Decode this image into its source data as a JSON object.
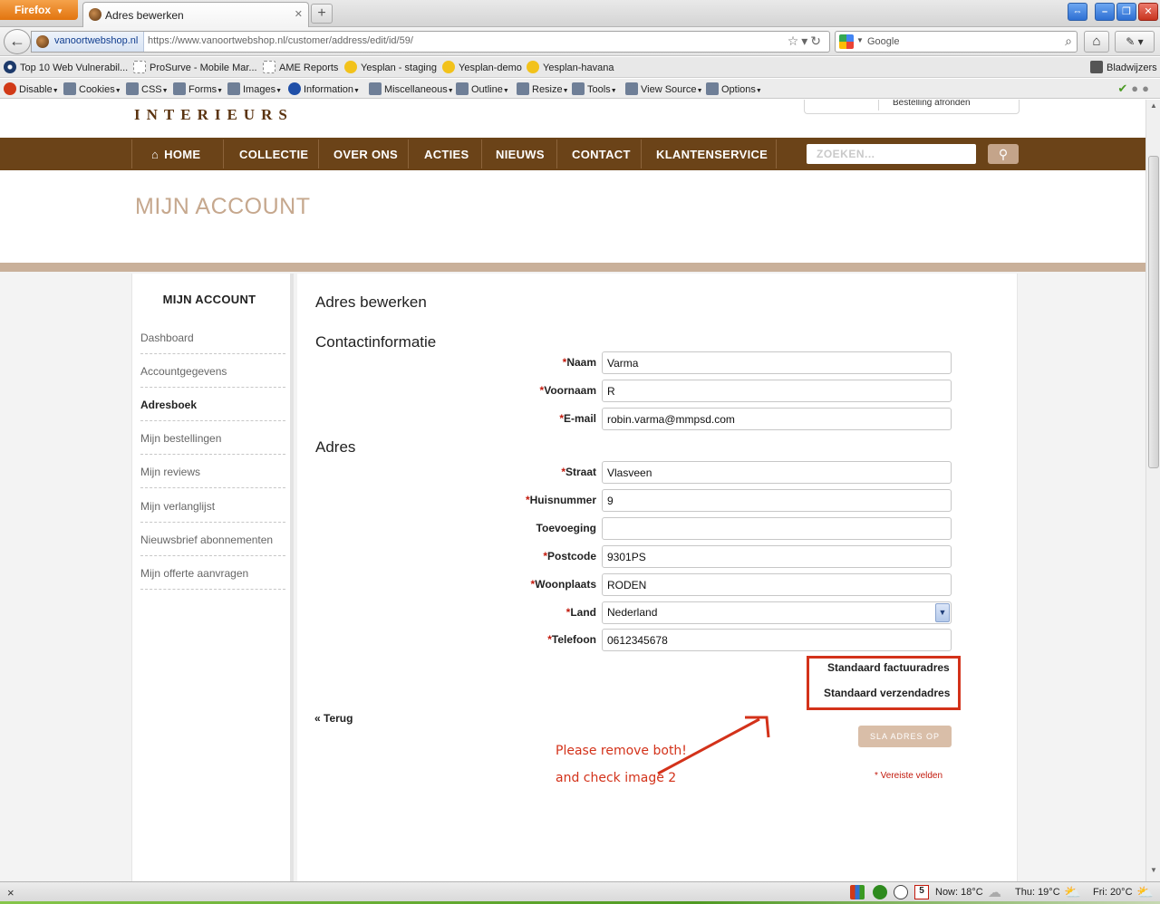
{
  "browser": {
    "app_button": "Firefox",
    "tab_title": "Adres bewerken",
    "site_identity": "vanoortwebshop.nl",
    "url": "https://www.vanoortwebshop.nl/customer/address/edit/id/59/",
    "search_placeholder": "Google"
  },
  "bookmarks": {
    "items": [
      "Top 10 Web Vulnerabil...",
      "ProSurve - Mobile Mar...",
      "AME Reports",
      "Yesplan - staging",
      "Yesplan-demo",
      "Yesplan-havana"
    ],
    "right": "Bladwijzers"
  },
  "webdev_toolbar": {
    "items": [
      "Disable",
      "Cookies",
      "CSS",
      "Forms",
      "Images",
      "Information",
      "Miscellaneous",
      "Outline",
      "Resize",
      "Tools",
      "View Source",
      "Options"
    ]
  },
  "site": {
    "logo_text": "INTERIEURS",
    "cart_link": "Bestelling afronden",
    "nav": [
      "HOME",
      "COLLECTIE",
      "OVER ONS",
      "ACTIES",
      "NIEUWS",
      "CONTACT",
      "KLANTENSERVICE"
    ],
    "search_placeholder": "ZOEKEN...",
    "page_title": "MIJN ACCOUNT"
  },
  "sidebar": {
    "title": "MIJN ACCOUNT",
    "items": [
      "Dashboard",
      "Accountgegevens",
      "Adresboek",
      "Mijn bestellingen",
      "Mijn reviews",
      "Mijn verlanglijst",
      "Nieuwsbrief abonnementen",
      "Mijn offerte aanvragen"
    ],
    "active": "Adresboek"
  },
  "form": {
    "heading": "Adres bewerken",
    "contact_heading": "Contactinformatie",
    "address_heading": "Adres",
    "required_marker": "*",
    "fields": {
      "naam": {
        "label": "Naam",
        "value": "Varma"
      },
      "voornaam": {
        "label": "Voornaam",
        "value": "R"
      },
      "email": {
        "label": "E-mail",
        "value": "robin.varma@mmpsd.com"
      },
      "straat": {
        "label": "Straat",
        "value": "Vlasveen"
      },
      "huisnummer": {
        "label": "Huisnummer",
        "value": "9"
      },
      "toevoeging": {
        "label": "Toevoeging",
        "value": ""
      },
      "postcode": {
        "label": "Postcode",
        "value": "9301PS"
      },
      "woonplaats": {
        "label": "Woonplaats",
        "value": "RODEN"
      },
      "land": {
        "label": "Land",
        "value": "Nederland"
      },
      "telefoon": {
        "label": "Telefoon",
        "value": "0612345678"
      }
    },
    "default_billing": "Standaard factuuradres",
    "default_shipping": "Standaard verzendadres",
    "back_link": "« Terug",
    "save_button": "SLA ADRES OP",
    "required_note": "* Vereiste velden"
  },
  "annotation": {
    "line1": "Please remove both!",
    "line2": "and check image 2",
    "color": "#d3321a"
  },
  "statusbar": {
    "close": "×",
    "weather_now": "Now: 18°C",
    "weather_thu": "Thu: 19°C",
    "weather_fri": "Fri: 20°C",
    "calendar_day": "5"
  },
  "colors": {
    "nav_brown": "#6b4318",
    "title_tan": "#c6a88e",
    "button_tan": "#d9bea8",
    "required_red": "#c2190c"
  }
}
